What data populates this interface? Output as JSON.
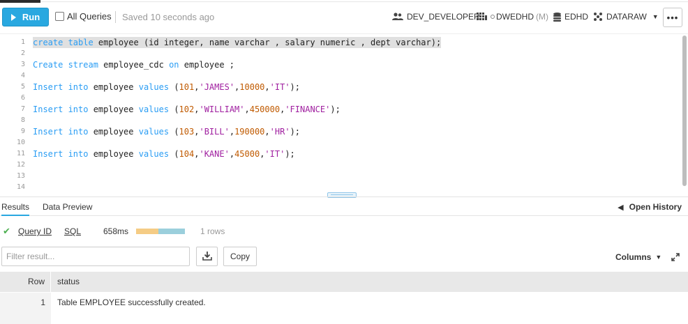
{
  "toolbar": {
    "run_label": "Run",
    "all_queries_label": "All Queries",
    "saved_status": "Saved 10 seconds ago",
    "role": "DEV_DEVELOPER",
    "warehouse": "DWEDHD",
    "warehouse_size": "(M)",
    "database": "EDHD",
    "schema": "DATARAW",
    "more_label": "•••"
  },
  "editor": {
    "lines": [
      {
        "n": "1",
        "tokens": [
          {
            "t": "create table",
            "c": "kw"
          },
          {
            "t": " employee (id integer, name varchar , salary numeric , dept varchar);",
            "c": "txt"
          }
        ],
        "highlight": true
      },
      {
        "n": "2",
        "tokens": []
      },
      {
        "n": "3",
        "tokens": [
          {
            "t": "Create stream",
            "c": "kw"
          },
          {
            "t": " employee_cdc ",
            "c": "txt"
          },
          {
            "t": "on",
            "c": "kw"
          },
          {
            "t": " employee ;",
            "c": "txt"
          }
        ]
      },
      {
        "n": "4",
        "tokens": []
      },
      {
        "n": "5",
        "tokens": [
          {
            "t": "Insert into",
            "c": "kw"
          },
          {
            "t": " employee ",
            "c": "txt"
          },
          {
            "t": "values",
            "c": "kw"
          },
          {
            "t": " (",
            "c": "txt"
          },
          {
            "t": "101",
            "c": "num"
          },
          {
            "t": ",",
            "c": "txt"
          },
          {
            "t": "'JAMES'",
            "c": "str"
          },
          {
            "t": ",",
            "c": "txt"
          },
          {
            "t": "10000",
            "c": "num"
          },
          {
            "t": ",",
            "c": "txt"
          },
          {
            "t": "'IT'",
            "c": "str"
          },
          {
            "t": ");",
            "c": "txt"
          }
        ]
      },
      {
        "n": "6",
        "tokens": []
      },
      {
        "n": "7",
        "tokens": [
          {
            "t": "Insert into",
            "c": "kw"
          },
          {
            "t": " employee ",
            "c": "txt"
          },
          {
            "t": "values",
            "c": "kw"
          },
          {
            "t": " (",
            "c": "txt"
          },
          {
            "t": "102",
            "c": "num"
          },
          {
            "t": ",",
            "c": "txt"
          },
          {
            "t": "'WILLIAM'",
            "c": "str"
          },
          {
            "t": ",",
            "c": "txt"
          },
          {
            "t": "450000",
            "c": "num"
          },
          {
            "t": ",",
            "c": "txt"
          },
          {
            "t": "'FINANCE'",
            "c": "str"
          },
          {
            "t": ");",
            "c": "txt"
          }
        ]
      },
      {
        "n": "8",
        "tokens": []
      },
      {
        "n": "9",
        "tokens": [
          {
            "t": "Insert into",
            "c": "kw"
          },
          {
            "t": " employee ",
            "c": "txt"
          },
          {
            "t": "values",
            "c": "kw"
          },
          {
            "t": " (",
            "c": "txt"
          },
          {
            "t": "103",
            "c": "num"
          },
          {
            "t": ",",
            "c": "txt"
          },
          {
            "t": "'BILL'",
            "c": "str"
          },
          {
            "t": ",",
            "c": "txt"
          },
          {
            "t": "190000",
            "c": "num"
          },
          {
            "t": ",",
            "c": "txt"
          },
          {
            "t": "'HR'",
            "c": "str"
          },
          {
            "t": ");",
            "c": "txt"
          }
        ]
      },
      {
        "n": "10",
        "tokens": []
      },
      {
        "n": "11",
        "tokens": [
          {
            "t": "Insert into",
            "c": "kw"
          },
          {
            "t": " employee ",
            "c": "txt"
          },
          {
            "t": "values",
            "c": "kw"
          },
          {
            "t": " (",
            "c": "txt"
          },
          {
            "t": "104",
            "c": "num"
          },
          {
            "t": ",",
            "c": "txt"
          },
          {
            "t": "'KANE'",
            "c": "str"
          },
          {
            "t": ",",
            "c": "txt"
          },
          {
            "t": "45000",
            "c": "num"
          },
          {
            "t": ",",
            "c": "txt"
          },
          {
            "t": "'IT'",
            "c": "str"
          },
          {
            "t": ");",
            "c": "txt"
          }
        ]
      },
      {
        "n": "12",
        "tokens": []
      },
      {
        "n": "13",
        "tokens": []
      },
      {
        "n": "14",
        "tokens": []
      }
    ]
  },
  "results": {
    "tab_results": "Results",
    "tab_preview": "Data Preview",
    "open_history": "Open History",
    "query_id_label": "Query ID",
    "sql_label": "SQL",
    "duration": "658ms",
    "duration_bar": [
      0.45,
      0.55
    ],
    "row_count": "1 rows",
    "filter_placeholder": "Filter result...",
    "copy_label": "Copy",
    "columns_label": "Columns",
    "header_row": "Row",
    "header_status": "status",
    "rows": [
      {
        "row": "1",
        "status": "Table EMPLOYEE successfully created."
      }
    ]
  },
  "colors": {
    "accent": "#29a8e0",
    "keyword": "#2a9df4",
    "string": "#a020a0",
    "number": "#c05a00",
    "success": "#4caf50"
  },
  "icons": [
    "user-group-icon",
    "warehouse-grid-icon",
    "database-icon",
    "schema-nodes-icon",
    "download-icon",
    "expand-icon",
    "check-icon",
    "arrow-left-icon",
    "play-icon"
  ]
}
